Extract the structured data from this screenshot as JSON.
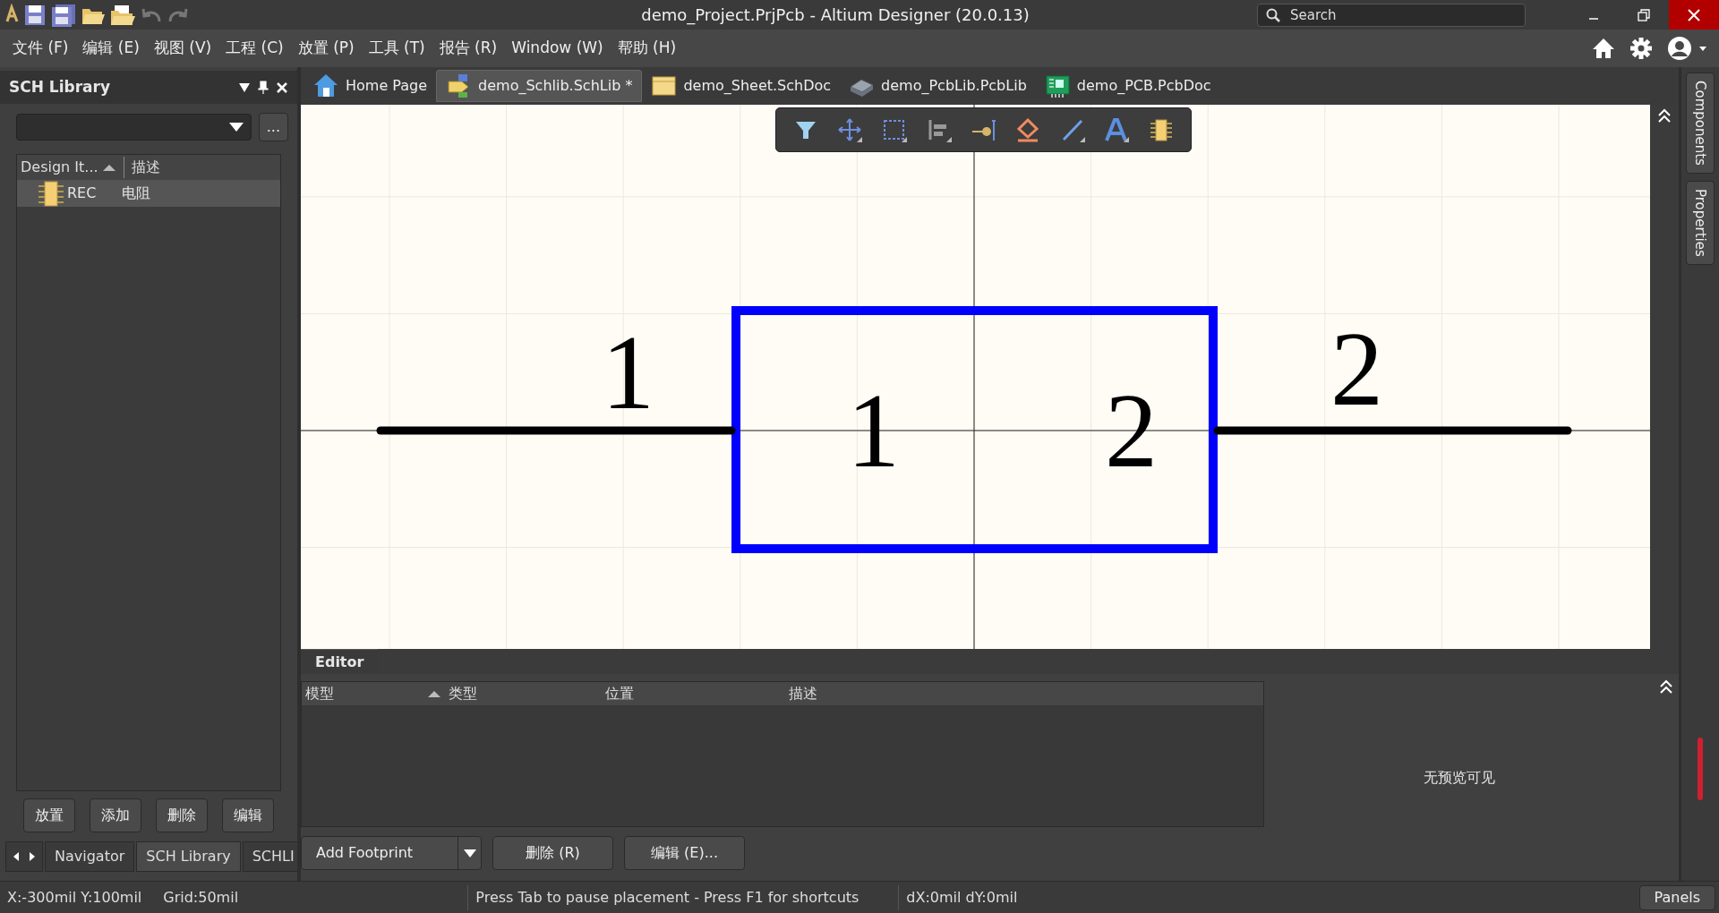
{
  "window": {
    "title": "demo_Project.PrjPcb - Altium Designer (20.0.13)",
    "search_placeholder": "Search"
  },
  "menu": [
    "文件 (F)",
    "编辑 (E)",
    "视图 (V)",
    "工程 (C)",
    "放置 (P)",
    "工具 (T)",
    "报告 (R)",
    "Window (W)",
    "帮助 (H)"
  ],
  "doc_tabs": [
    {
      "label": "Home Page",
      "kind": "home",
      "selected": false
    },
    {
      "label": "demo_Schlib.SchLib *",
      "kind": "schlib",
      "selected": true
    },
    {
      "label": "demo_Sheet.SchDoc",
      "kind": "schdoc",
      "selected": false
    },
    {
      "label": "demo_PcbLib.PcbLib",
      "kind": "pcblib",
      "selected": false
    },
    {
      "label": "demo_PCB.PcbDoc",
      "kind": "pcbdoc",
      "selected": false
    }
  ],
  "left_panel": {
    "title": "SCH Library",
    "more_button": "...",
    "columns": [
      "Design It...",
      "描述"
    ],
    "rows": [
      {
        "name": "REC",
        "description": "电阻",
        "selected": true
      }
    ],
    "buttons": [
      "放置",
      "添加",
      "删除",
      "编辑"
    ],
    "bottom_tabs": [
      {
        "label": "Navigator",
        "selected": false
      },
      {
        "label": "SCH Library",
        "selected": true
      },
      {
        "label": "SCHLI",
        "selected": false
      }
    ]
  },
  "schematic": {
    "pins": [
      {
        "designator": "1",
        "name": "1"
      },
      {
        "designator": "2",
        "name": "2"
      }
    ]
  },
  "editor": {
    "tab": "Editor",
    "columns": [
      "模型",
      "类型",
      "位置",
      "描述"
    ],
    "preview": "无预览可见",
    "buttons": [
      {
        "label": "Add Footprint",
        "kind": "split"
      },
      {
        "label": "删除 (R)",
        "kind": "plain"
      },
      {
        "label": "编辑 (E)...",
        "kind": "plain"
      }
    ]
  },
  "right_tabs": [
    "Components",
    "Properties"
  ],
  "status_bar": {
    "coords": "X:-300mil Y:100mil",
    "grid": "Grid:50mil",
    "hint": "Press Tab to pause placement - Press F1 for shortcuts",
    "delta": "dX:0mil dY:0mil",
    "panels_button": "Panels"
  }
}
